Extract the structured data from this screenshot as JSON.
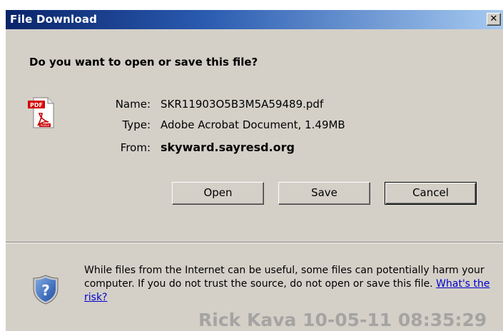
{
  "window": {
    "title": "File Download",
    "close_glyph": "✕"
  },
  "dialog": {
    "question": "Do you want to open or save this file?",
    "file_icon": "pdf-file-icon",
    "fields": {
      "name_label": "Name:",
      "name_value": "SKR11903O5B3M5A59489.pdf",
      "type_label": "Type:",
      "type_value": "Adobe Acrobat Document, 1.49MB",
      "from_label": "From:",
      "from_value": "skyward.sayresd.org"
    },
    "buttons": {
      "open": "Open",
      "save": "Save",
      "cancel": "Cancel"
    }
  },
  "warning": {
    "icon": "shield-question-icon",
    "text": "While files from the Internet can be useful, some files can potentially harm your computer. If you do not trust the source, do not open or save this file. ",
    "link": "What's the risk?"
  },
  "watermark": "Rick Kava 10-05-11 08:35:29",
  "colors": {
    "titlebar_start": "#0a246a",
    "titlebar_end": "#a6caf0",
    "dialog_bg": "#d4d0c8",
    "link": "#0000cc"
  }
}
